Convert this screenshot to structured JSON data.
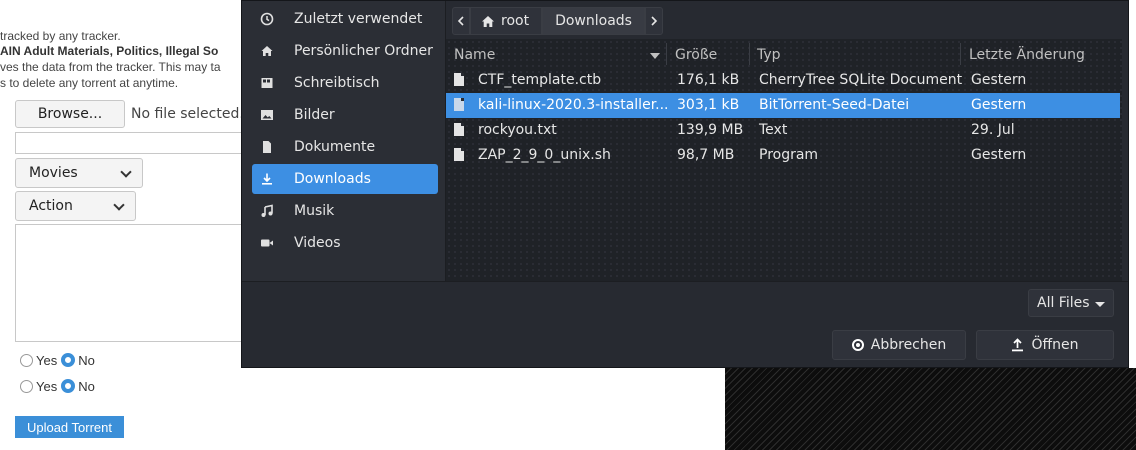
{
  "webpage": {
    "line1": "tracked by any tracker.",
    "line2": "AIN Adult Materials, Politics, Illegal So",
    "line3": "ves the data from the tracker. This may ta",
    "line4": "s to delete any torrent at anytime.",
    "browse_label": "Browse...",
    "file_status": "No file selected.",
    "category_value": "Movies",
    "genre_value": "Action",
    "radio_yes": "Yes",
    "radio_no": "No",
    "upload_label": "Upload Torrent"
  },
  "dialog": {
    "sidebar": [
      {
        "icon": "clock-icon",
        "label": "Zuletzt verwendet"
      },
      {
        "icon": "home-icon",
        "label": "Persönlicher Ordner"
      },
      {
        "icon": "desktop-icon",
        "label": "Schreibtisch"
      },
      {
        "icon": "image-icon",
        "label": "Bilder"
      },
      {
        "icon": "document-icon",
        "label": "Dokumente"
      },
      {
        "icon": "download-icon",
        "label": "Downloads"
      },
      {
        "icon": "music-icon",
        "label": "Musik"
      },
      {
        "icon": "video-icon",
        "label": "Videos"
      }
    ],
    "path": {
      "root": "root",
      "current": "Downloads"
    },
    "columns": {
      "name": "Name",
      "size": "Größe",
      "type": "Typ",
      "modified": "Letzte Änderung"
    },
    "files": [
      {
        "name": "CTF_template.ctb",
        "size": "176,1 kB",
        "type": "CherryTree SQLite Document",
        "modified": "Gestern"
      },
      {
        "name": "kali-linux-2020.3-installer...",
        "size": "303,1 kB",
        "type": "BitTorrent-Seed-Datei",
        "modified": "Gestern"
      },
      {
        "name": "rockyou.txt",
        "size": "139,9 MB",
        "type": "Text",
        "modified": "29. Jul"
      },
      {
        "name": "ZAP_2_9_0_unix.sh",
        "size": "98,7 MB",
        "type": "Program",
        "modified": "Gestern"
      }
    ],
    "filter": "All Files",
    "cancel_label": "Abbrechen",
    "open_label": "Öffnen",
    "accent": "#3d8fe3"
  }
}
